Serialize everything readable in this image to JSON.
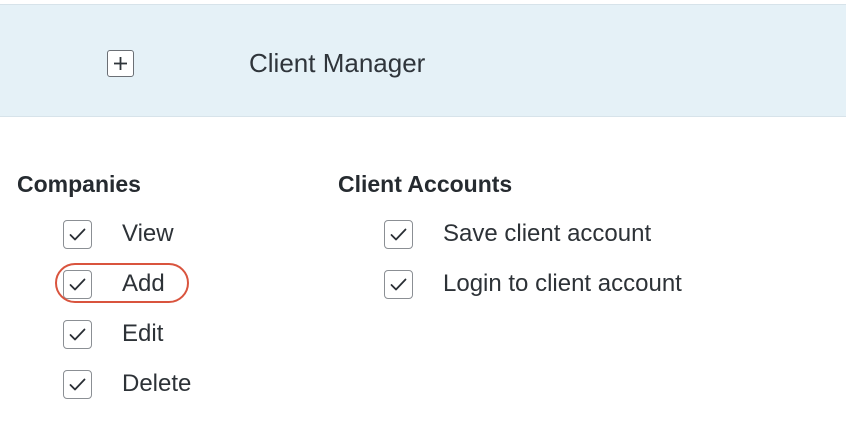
{
  "header": {
    "title": "Client Manager",
    "expand_icon": "plus-icon"
  },
  "sections": {
    "companies": {
      "title": "Companies",
      "items": [
        {
          "label": "View",
          "checked": true
        },
        {
          "label": "Add",
          "checked": true
        },
        {
          "label": "Edit",
          "checked": true
        },
        {
          "label": "Delete",
          "checked": true
        }
      ]
    },
    "client_accounts": {
      "title": "Client Accounts",
      "items": [
        {
          "label": "Save client account",
          "checked": true
        },
        {
          "label": "Login to client account",
          "checked": true
        }
      ]
    }
  },
  "colors": {
    "header_bg": "#e5f1f7",
    "highlight": "#d9543e",
    "text": "#2a2f35"
  },
  "icons": {
    "check": "checkmark-icon"
  }
}
